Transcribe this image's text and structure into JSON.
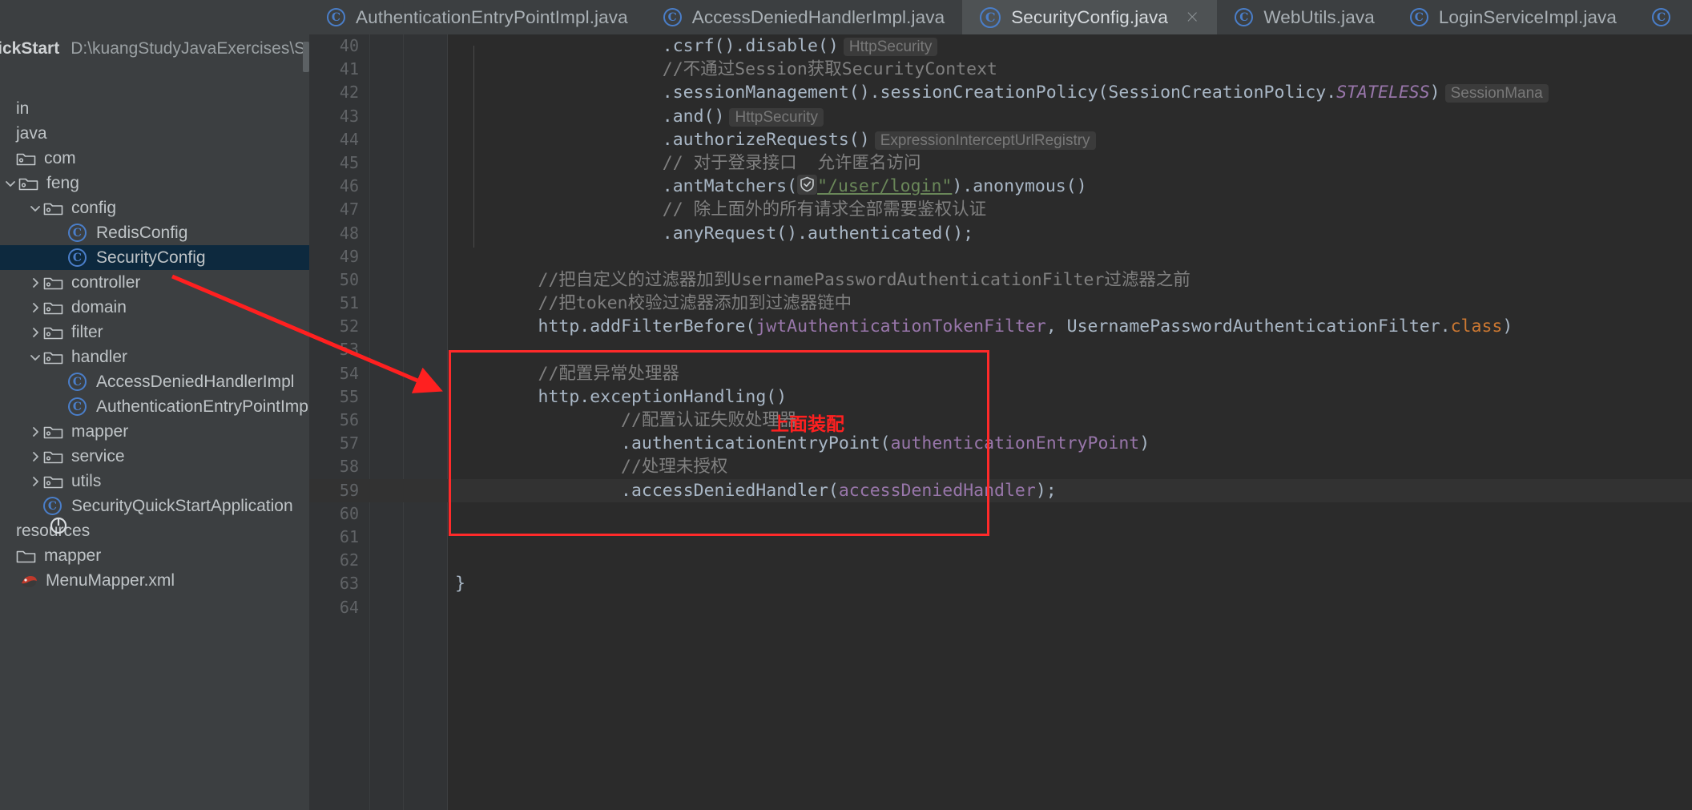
{
  "window": {
    "project_name": "QuickStart",
    "project_path": "D:\\kuangStudyJavaExercises\\SecurityQ"
  },
  "tabs": [
    {
      "label": "AuthenticationEntryPointImpl.java",
      "icon": "java-class-icon",
      "active": false,
      "closeable": false
    },
    {
      "label": "AccessDeniedHandlerImpl.java",
      "icon": "java-class-icon",
      "active": false,
      "closeable": false
    },
    {
      "label": "SecurityConfig.java",
      "icon": "java-class-icon",
      "active": true,
      "closeable": true,
      "close_label": "×"
    },
    {
      "label": "WebUtils.java",
      "icon": "java-class-icon",
      "active": false,
      "closeable": false
    },
    {
      "label": "LoginServiceImpl.java",
      "icon": "java-class-icon",
      "active": false,
      "closeable": false
    },
    {
      "label": "",
      "icon": "java-class-icon",
      "active": false,
      "closeable": false
    }
  ],
  "tree": [
    {
      "label": "in",
      "indent": 0,
      "arrow": "",
      "icon": "none",
      "selected": false
    },
    {
      "label": "java",
      "indent": 0,
      "arrow": "",
      "icon": "none",
      "selected": false
    },
    {
      "label": "com",
      "indent": 0,
      "arrow": "",
      "icon": "folder",
      "selected": false
    },
    {
      "label": "feng",
      "indent": 1,
      "arrow": "v",
      "icon": "folder",
      "selected": false
    },
    {
      "label": "config",
      "indent": 2,
      "arrow": "v",
      "icon": "folder",
      "selected": false
    },
    {
      "label": "RedisConfig",
      "indent": 3,
      "arrow": "",
      "icon": "class",
      "selected": false
    },
    {
      "label": "SecurityConfig",
      "indent": 3,
      "arrow": "",
      "icon": "class",
      "selected": true
    },
    {
      "label": "controller",
      "indent": 2,
      "arrow": ">",
      "icon": "folder",
      "selected": false
    },
    {
      "label": "domain",
      "indent": 2,
      "arrow": ">",
      "icon": "folder",
      "selected": false
    },
    {
      "label": "filter",
      "indent": 2,
      "arrow": ">",
      "icon": "folder",
      "selected": false
    },
    {
      "label": "handler",
      "indent": 2,
      "arrow": "v",
      "icon": "folder",
      "selected": false
    },
    {
      "label": "AccessDeniedHandlerImpl",
      "indent": 3,
      "arrow": "",
      "icon": "class",
      "selected": false
    },
    {
      "label": "AuthenticationEntryPointImpl",
      "indent": 3,
      "arrow": "",
      "icon": "class",
      "selected": false
    },
    {
      "label": "mapper",
      "indent": 2,
      "arrow": ">",
      "icon": "folder",
      "selected": false
    },
    {
      "label": "service",
      "indent": 2,
      "arrow": ">",
      "icon": "folder",
      "selected": false
    },
    {
      "label": "utils",
      "indent": 2,
      "arrow": ">",
      "icon": "folder",
      "selected": false
    },
    {
      "label": "SecurityQuickStartApplication",
      "indent": 2,
      "arrow": "",
      "icon": "class",
      "selected": false
    },
    {
      "label": "resources",
      "indent": 0,
      "arrow": "",
      "icon": "none",
      "selected": false
    },
    {
      "label": "mapper",
      "indent": 0,
      "arrow": "",
      "icon": "folder-plain",
      "selected": false
    },
    {
      "label": "MenuMapper.xml",
      "indent": 1,
      "arrow": "",
      "icon": "xml",
      "selected": false
    }
  ],
  "editor": {
    "filename": "SecurityConfig.java",
    "current_line": 59,
    "lines": [
      {
        "n": "40",
        "indent": 20,
        "parts": [
          {
            "t": ".csrf().disable()",
            "c": "plain"
          },
          {
            "t": "HttpSecurity",
            "c": "hint"
          }
        ]
      },
      {
        "n": "41",
        "indent": 20,
        "parts": [
          {
            "t": "//不通过Session获取SecurityContext",
            "c": "cmt"
          }
        ]
      },
      {
        "n": "42",
        "indent": 20,
        "parts": [
          {
            "t": ".sessionManagement().sessionCreationPolicy(SessionCreationPolicy.",
            "c": "plain"
          },
          {
            "t": "STATELESS",
            "c": "stat"
          },
          {
            "t": ")",
            "c": "plain"
          },
          {
            "t": "SessionMana",
            "c": "hint"
          }
        ]
      },
      {
        "n": "43",
        "indent": 20,
        "parts": [
          {
            "t": ".and()",
            "c": "plain"
          },
          {
            "t": "HttpSecurity",
            "c": "hint"
          }
        ]
      },
      {
        "n": "44",
        "indent": 20,
        "parts": [
          {
            "t": ".authorizeRequests()",
            "c": "plain"
          },
          {
            "t": "ExpressionInterceptUrlRegistry",
            "c": "hint"
          }
        ]
      },
      {
        "n": "45",
        "indent": 20,
        "parts": [
          {
            "t": "// 对于登录接口  允许匿名访问",
            "c": "cmt"
          }
        ]
      },
      {
        "n": "46",
        "indent": 20,
        "parts": [
          {
            "t": ".antMatchers(",
            "c": "plain"
          },
          {
            "t": "",
            "c": "shield"
          },
          {
            "t": "\"/user/login\"",
            "c": "str"
          },
          {
            "t": ").anonymous()",
            "c": "plain"
          }
        ]
      },
      {
        "n": "47",
        "indent": 20,
        "parts": [
          {
            "t": "// 除上面外的所有请求全部需要鉴权认证",
            "c": "cmt"
          }
        ]
      },
      {
        "n": "48",
        "indent": 20,
        "parts": [
          {
            "t": ".anyRequest().authenticated();",
            "c": "plain"
          }
        ]
      },
      {
        "n": "49",
        "indent": 0,
        "parts": []
      },
      {
        "n": "50",
        "indent": 8,
        "parts": [
          {
            "t": "//把自定义的过滤器加到UsernamePasswordAuthenticationFilter过滤器之前",
            "c": "cmt"
          }
        ]
      },
      {
        "n": "51",
        "indent": 8,
        "parts": [
          {
            "t": "//把token校验过滤器添加到过滤器链中",
            "c": "cmt"
          }
        ]
      },
      {
        "n": "52",
        "indent": 8,
        "parts": [
          {
            "t": "http.addFilterBefore(",
            "c": "plain"
          },
          {
            "t": "jwtAuthenticationTokenFilter",
            "c": "fld"
          },
          {
            "t": ", UsernamePasswordAuthenticationFilter.",
            "c": "plain"
          },
          {
            "t": "class",
            "c": "kw"
          },
          {
            "t": ")",
            "c": "plain"
          }
        ]
      },
      {
        "n": "53",
        "indent": 0,
        "parts": []
      },
      {
        "n": "54",
        "indent": 8,
        "parts": [
          {
            "t": "//配置异常处理器",
            "c": "cmt"
          }
        ]
      },
      {
        "n": "55",
        "indent": 8,
        "parts": [
          {
            "t": "http.exceptionHandling()",
            "c": "plain"
          }
        ]
      },
      {
        "n": "56",
        "indent": 16,
        "parts": [
          {
            "t": "//配置认证失败处理器",
            "c": "cmt"
          }
        ]
      },
      {
        "n": "57",
        "indent": 16,
        "parts": [
          {
            "t": ".authenticationEntryPoint(",
            "c": "plain"
          },
          {
            "t": "authenticationEntryPoint",
            "c": "fld"
          },
          {
            "t": ")",
            "c": "plain"
          }
        ]
      },
      {
        "n": "58",
        "indent": 16,
        "parts": [
          {
            "t": "//处理未授权",
            "c": "cmt"
          }
        ]
      },
      {
        "n": "59",
        "indent": 16,
        "parts": [
          {
            "t": ".accessDeniedHandler(",
            "c": "plain"
          },
          {
            "t": "accessDeniedHandler",
            "c": "fld"
          },
          {
            "t": ");",
            "c": "plain"
          }
        ]
      },
      {
        "n": "60",
        "indent": 0,
        "parts": []
      },
      {
        "n": "61",
        "indent": 0,
        "parts": []
      },
      {
        "n": "62",
        "indent": 0,
        "parts": []
      },
      {
        "n": "63",
        "indent": 0,
        "parts": [
          {
            "t": "}",
            "c": "plain"
          }
        ]
      },
      {
        "n": "64",
        "indent": 0,
        "parts": []
      }
    ]
  },
  "annotations": {
    "red_label": "上面装配",
    "red_color": "#ff2020",
    "box_note": "red rectangle around exception handler block",
    "arrow_note": "red arrow from SecurityConfig tree node to line 55"
  }
}
